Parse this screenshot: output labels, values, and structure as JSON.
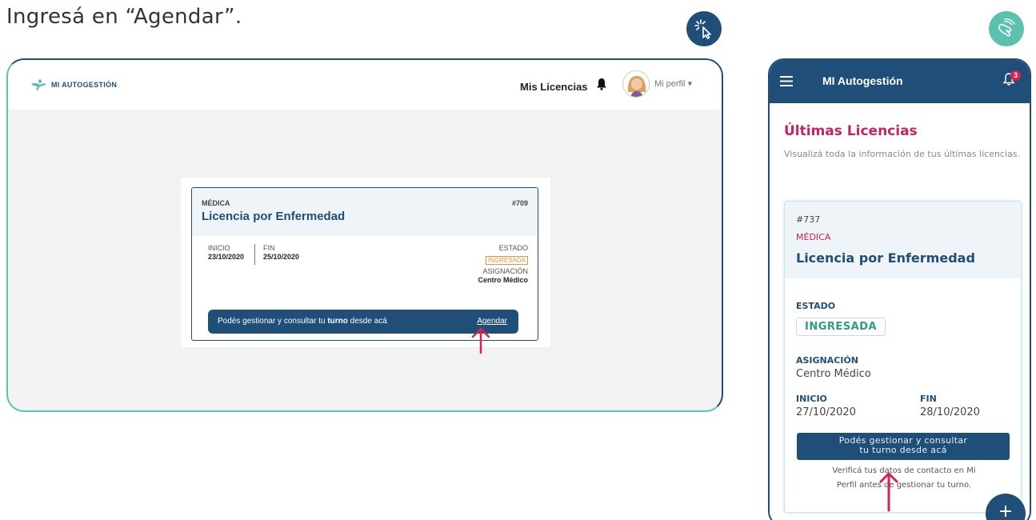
{
  "instruction": "Ingresá en “Agendar”.",
  "badges": {
    "desktop_icon": "click-cursor-icon",
    "mobile_icon": "tap-hand-icon"
  },
  "colors": {
    "navy": "#1f4e79",
    "teal": "#5cc2b0",
    "pink": "#c8245c",
    "orange": "#e8913c",
    "green": "#2e9c84",
    "arrow": "#d9224a"
  },
  "desktop": {
    "logo_text": "MI AUTOGESTIÓN",
    "nav_link": "Mis Licencias",
    "profile_label": "Mi perfil",
    "card": {
      "category": "MÉDICA",
      "number": "#709",
      "title": "Licencia por Enfermedad",
      "start_label": "INICIO",
      "start_value": "23/10/2020",
      "end_label": "FIN",
      "end_value": "25/10/2020",
      "status_label": "ESTADO",
      "status_value": "INGRESADA",
      "assignment_label": "ASIGNACIÓN",
      "assignment_value": "Centro Médico",
      "turno_text_before": "Podés gestionar y consultar tu ",
      "turno_text_bold": "turno",
      "turno_text_after": " desde acá",
      "turno_link": "Agendar"
    }
  },
  "mobile": {
    "app_title": "MI Autogestión",
    "notification_count": "3",
    "section_title": "Últimas Licencias",
    "section_desc": "Visualizá toda la información de tus últimas licencias.",
    "card": {
      "number": "#737",
      "category": "MÉDICA",
      "title": "Licencia por Enfermedad",
      "status_label": "ESTADO",
      "status_value": "INGRESADA",
      "assignment_label": "ASIGNACIÓN",
      "assignment_value": "Centro Médico",
      "start_label": "INICIO",
      "start_value": "27/10/2020",
      "end_label": "FIN",
      "end_value": "28/10/2020",
      "turno_line1": "Podés gestionar y consultar",
      "turno_line2": "tu turno desde acá",
      "verify_line1": "Verificá tus datos de contacto en Mi",
      "verify_line2": "Perfil antes de gestionar tu turno."
    },
    "fab_label": "+"
  }
}
